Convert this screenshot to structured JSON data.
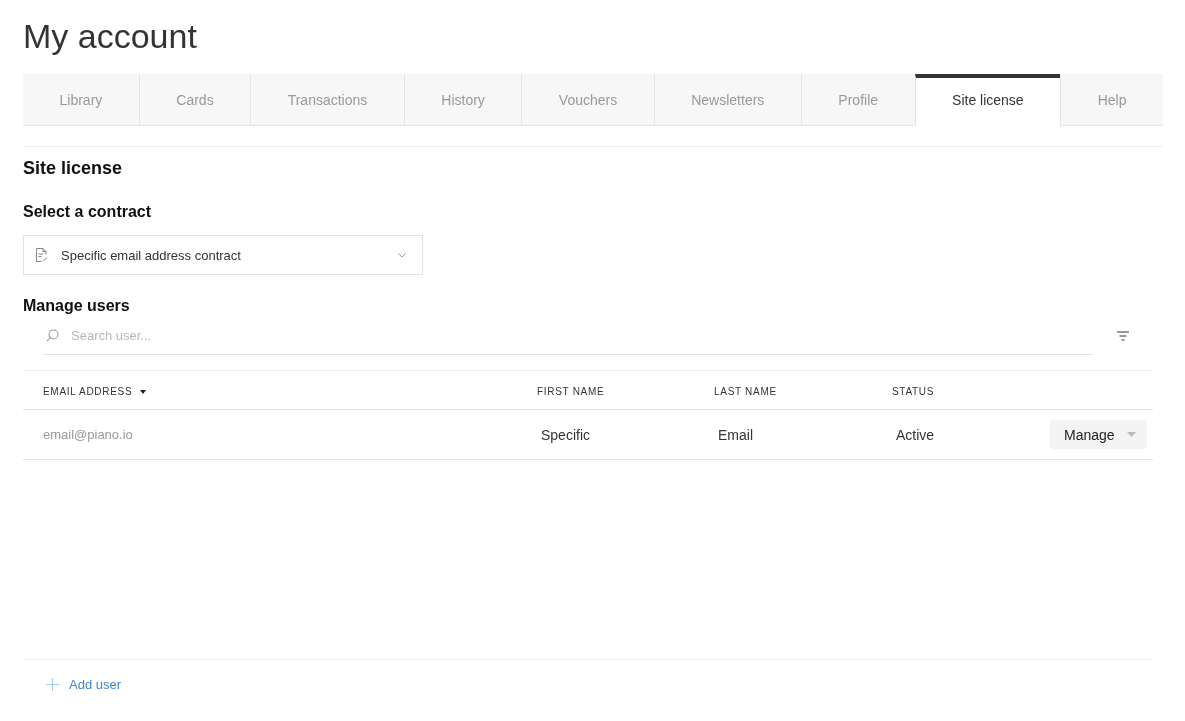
{
  "page_title": "My account",
  "tabs": [
    {
      "label": "Library",
      "selected": false
    },
    {
      "label": "Cards",
      "selected": false
    },
    {
      "label": "Transactions",
      "selected": false
    },
    {
      "label": "History",
      "selected": false
    },
    {
      "label": "Vouchers",
      "selected": false
    },
    {
      "label": "Newsletters",
      "selected": false
    },
    {
      "label": "Profile",
      "selected": false
    },
    {
      "label": "Site license",
      "selected": true
    },
    {
      "label": "Help",
      "selected": false
    }
  ],
  "section_title": "Site license",
  "contract": {
    "label": "Select a contract",
    "value": "Specific email address contract"
  },
  "manage_users": {
    "title": "Manage users",
    "search": {
      "placeholder": "Search user..."
    }
  },
  "table": {
    "columns": [
      {
        "label": "EMAIL ADDRESS",
        "sorted": true
      },
      {
        "label": "FIRST NAME",
        "sorted": false
      },
      {
        "label": "LAST NAME",
        "sorted": false
      },
      {
        "label": "STATUS",
        "sorted": false
      }
    ],
    "rows": [
      {
        "cells": [
          "email@piano.io",
          "Specific",
          "Email",
          "Active"
        ],
        "action": "Manage"
      }
    ]
  },
  "add_user": "Add user"
}
